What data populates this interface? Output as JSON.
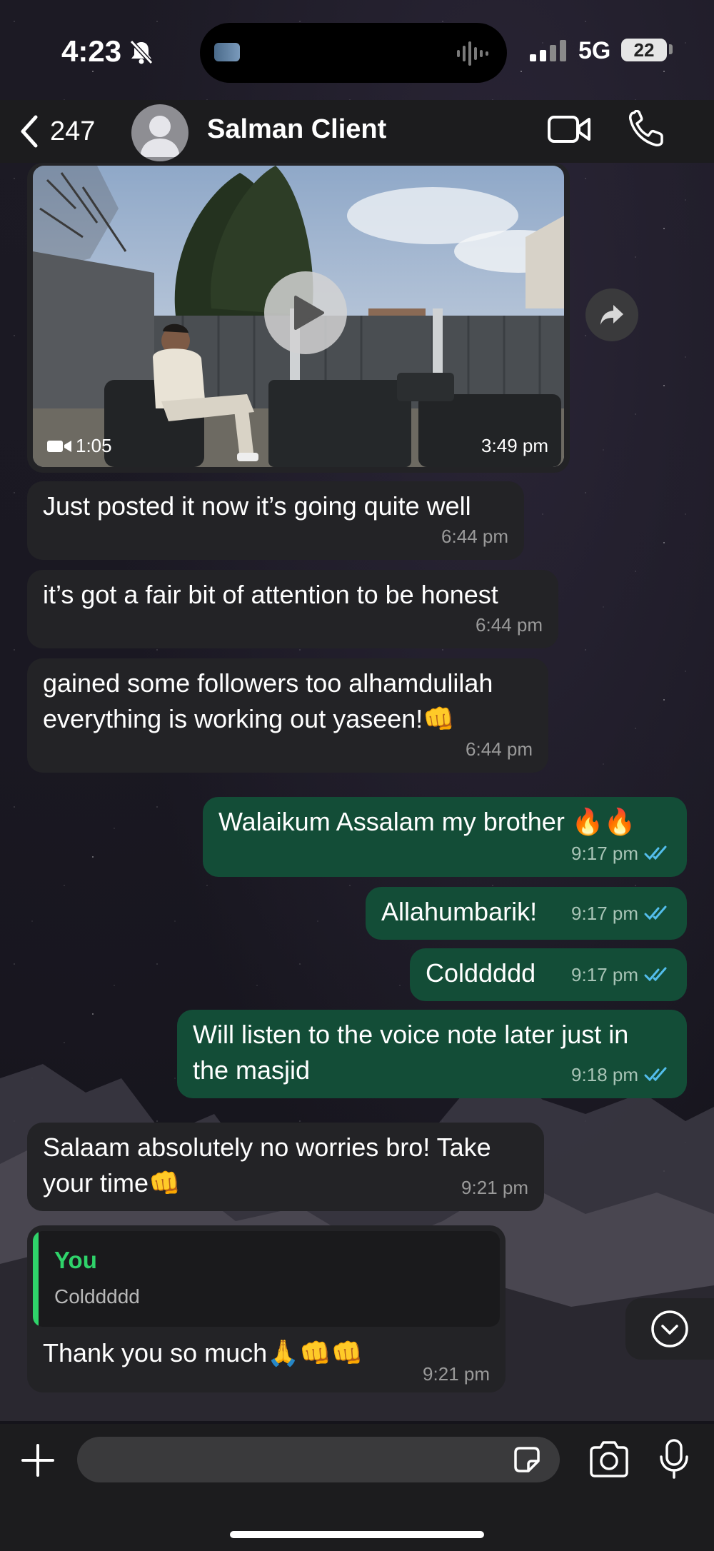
{
  "status_bar": {
    "time": "4:23",
    "network": "5G",
    "battery": "22"
  },
  "header": {
    "back_count": "247",
    "contact_name": "Salman Client"
  },
  "video_message": {
    "duration": "1:05",
    "time": "3:49 pm"
  },
  "messages": [
    {
      "direction": "in",
      "text": "Just posted it now it’s going quite well",
      "time": "6:44 pm"
    },
    {
      "direction": "in",
      "text": "it’s got a fair bit of attention to be honest",
      "time": "6:44 pm"
    },
    {
      "direction": "in",
      "text": "gained some followers too alhamdulilah\neverything is working out yaseen!👊",
      "time": "6:44 pm"
    },
    {
      "direction": "out",
      "text": "Walaikum Assalam my brother 🔥🔥",
      "time": "9:17 pm"
    },
    {
      "direction": "out",
      "text": "Allahumbarik!",
      "time": "9:17 pm"
    },
    {
      "direction": "out",
      "text": "Colddddd",
      "time": "9:17 pm"
    },
    {
      "direction": "out",
      "text": "Will listen to the voice note later just in\nthe masjid",
      "time": "9:18 pm"
    },
    {
      "direction": "in",
      "text": "Salaam absolutely no worries bro! Take\nyour time👊",
      "time": "9:21 pm"
    }
  ],
  "reply_message": {
    "quoted_author": "You",
    "quoted_text": "Colddddd",
    "text": "Thank you so much🙏👊👊",
    "time": "9:21 pm"
  },
  "composer": {
    "placeholder": ""
  },
  "colors": {
    "accent": "#2fd36a",
    "outgoing_bubble": "#134d37",
    "incoming_bubble": "#232326",
    "read_ticks": "#53bdeb"
  },
  "icons": [
    "bell-slash-icon",
    "back-chevron-icon",
    "video-call-icon",
    "phone-icon",
    "play-icon",
    "forward-icon",
    "chevron-down-icon",
    "plus-icon",
    "sticker-icon",
    "camera-icon",
    "mic-icon"
  ]
}
